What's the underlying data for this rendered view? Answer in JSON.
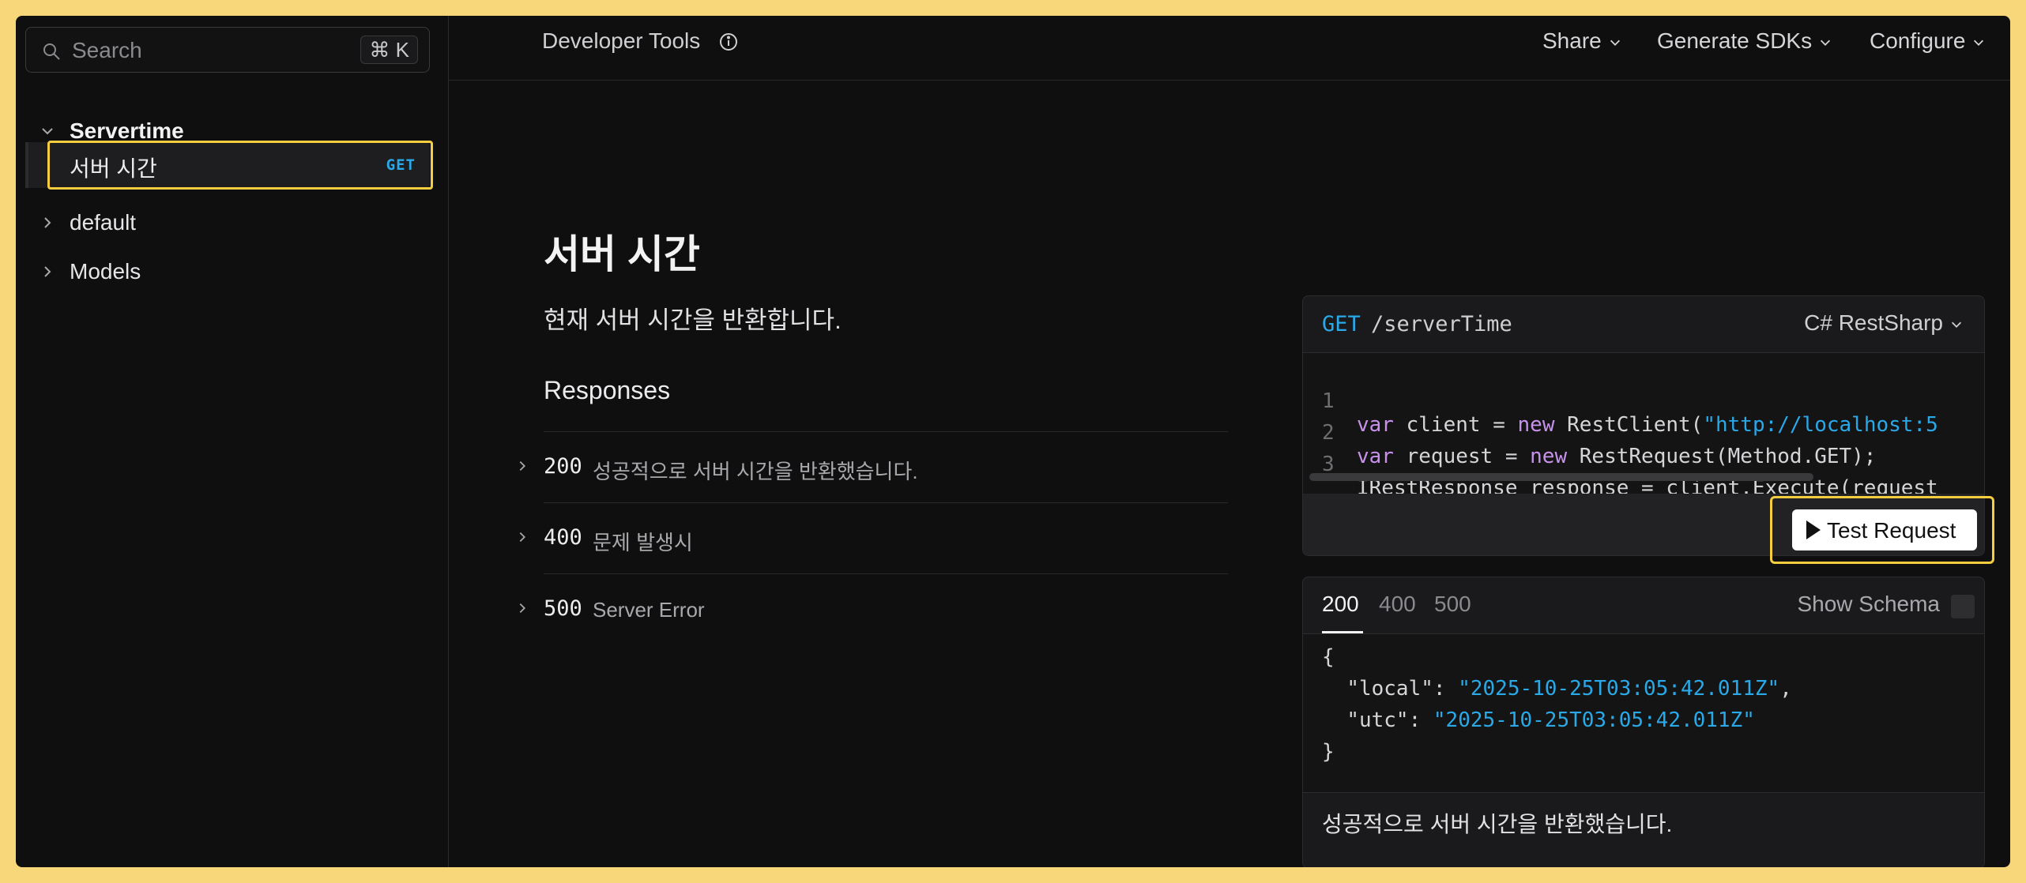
{
  "sidebar": {
    "search": {
      "placeholder": "Search",
      "shortcut": "⌘ K"
    },
    "groups": [
      {
        "label": "Servertime",
        "expanded": true,
        "items": [
          {
            "label": "서버 시간",
            "method": "GET"
          }
        ]
      },
      {
        "label": "default",
        "expanded": false
      },
      {
        "label": "Models",
        "expanded": false
      }
    ]
  },
  "header": {
    "title": "Developer Tools",
    "actions": [
      "Share",
      "Generate SDKs",
      "Configure"
    ]
  },
  "main": {
    "title": "서버 시간",
    "description": "현재 서버 시간을 반환합니다.",
    "responses_heading": "Responses",
    "responses": [
      {
        "code": "200",
        "text": "성공적으로 서버 시간을 반환했습니다."
      },
      {
        "code": "400",
        "text": "문제 발생시"
      },
      {
        "code": "500",
        "text": "Server Error"
      }
    ]
  },
  "code_panel": {
    "method": "GET",
    "path": "/serverTime",
    "language": "C# RestSharp",
    "lines": [
      {
        "n": "1",
        "kw": "var",
        "a": " client = ",
        "kw2": "new",
        "b": " RestClient(",
        "str": "\"http://localhost:5",
        "c": ""
      },
      {
        "n": "2",
        "kw": "var",
        "a": " request = ",
        "kw2": "new",
        "b": " RestRequest(Method.GET);",
        "str": "",
        "c": ""
      },
      {
        "n": "3",
        "kw": "",
        "a": "IRestResponse response = client.Execute(request",
        "kw2": "",
        "b": "",
        "str": "",
        "c": ""
      }
    ],
    "test_button": "Test Request"
  },
  "response_panel": {
    "tabs": [
      "200",
      "400",
      "500"
    ],
    "active_tab": "200",
    "show_schema": "Show Schema",
    "json_lines": [
      {
        "t": "{",
        "key": "",
        "sep": "",
        "val": "",
        "end": ""
      },
      {
        "t": "  ",
        "key": "\"local\"",
        "sep": ": ",
        "val": "\"2025-10-25T03:05:42.011Z\"",
        "end": ","
      },
      {
        "t": "  ",
        "key": "\"utc\"",
        "sep": ": ",
        "val": "\"2025-10-25T03:05:42.011Z\"",
        "end": ""
      },
      {
        "t": "}",
        "key": "",
        "sep": "",
        "val": "",
        "end": ""
      }
    ],
    "footer": "성공적으로 서버 시간을 반환했습니다."
  },
  "colors": {
    "accent": "#2aa9e8",
    "highlight": "#f6cd3f",
    "keyword": "#c792ea",
    "background": "#0f0f10"
  }
}
